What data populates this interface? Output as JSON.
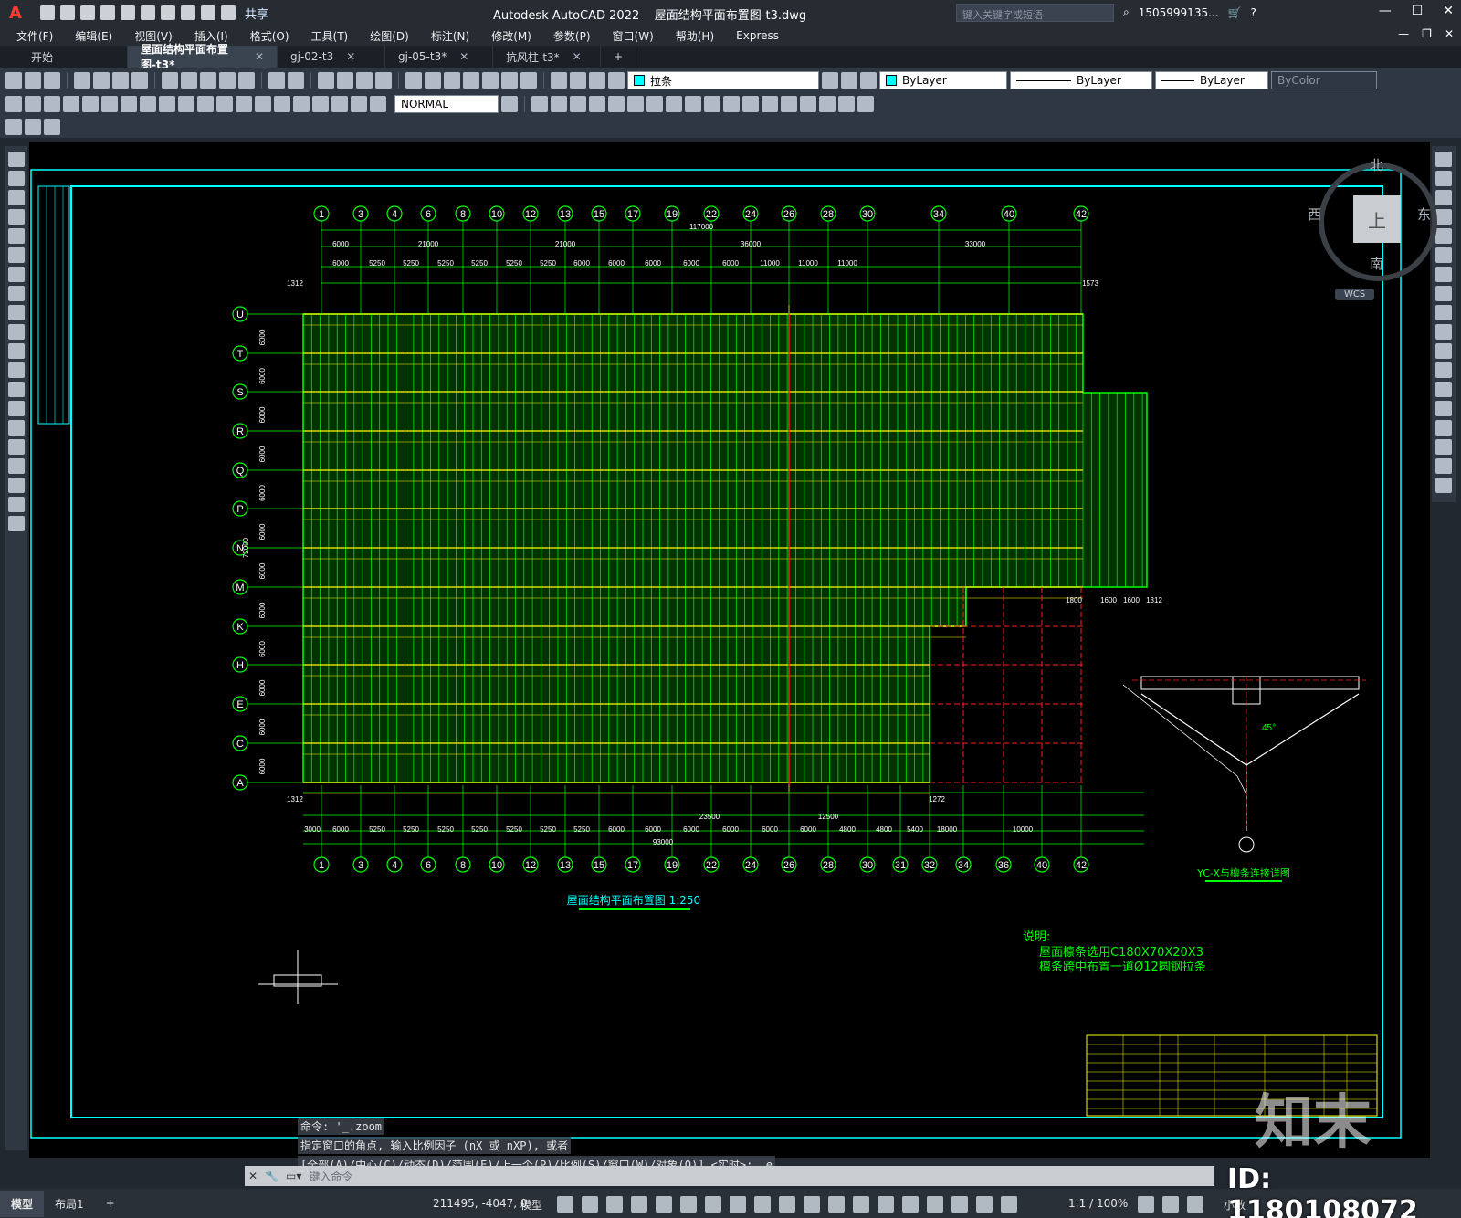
{
  "app": {
    "title": "Autodesk AutoCAD 2022",
    "file": "屋面结构平面布置图-t3.dwg",
    "share_label": "共享",
    "search_placeholder": "键入关键字或短语",
    "user": "1505999135...",
    "logo": "A"
  },
  "menu": [
    "文件(F)",
    "编辑(E)",
    "视图(V)",
    "插入(I)",
    "格式(O)",
    "工具(T)",
    "绘图(D)",
    "标注(N)",
    "修改(M)",
    "参数(P)",
    "窗口(W)",
    "帮助(H)",
    "Express"
  ],
  "tabs": [
    {
      "label": "开始",
      "active": false
    },
    {
      "label": "屋面结构平面布置图-t3*",
      "active": true
    },
    {
      "label": "gj-02-t3",
      "active": false
    },
    {
      "label": "gj-05-t3*",
      "active": false
    },
    {
      "label": "抗风柱-t3*",
      "active": false
    }
  ],
  "toolbar": {
    "layer": "拉条",
    "color": "ByLayer",
    "linetype": "ByLayer",
    "lineweight": "ByLayer",
    "plotstyle": "ByColor",
    "textstyle": "NORMAL"
  },
  "viewcube": {
    "n": "北",
    "s": "南",
    "e": "东",
    "w": "西",
    "top": "上",
    "wcs": "WCS"
  },
  "drawing": {
    "axes_top": [
      "1",
      "3",
      "4",
      "6",
      "8",
      "10",
      "12",
      "13",
      "15",
      "17",
      "19",
      "22",
      "24",
      "26",
      "28",
      "30",
      "34",
      "40",
      "42"
    ],
    "axes_bottom": [
      "1",
      "3",
      "4",
      "6",
      "8",
      "10",
      "12",
      "13",
      "15",
      "17",
      "19",
      "22",
      "24",
      "26",
      "28",
      "30",
      "31",
      "32",
      "34",
      "36",
      "40",
      "42"
    ],
    "axes_left": [
      "U",
      "T",
      "S",
      "R",
      "Q",
      "P",
      "N",
      "M",
      "K",
      "H",
      "E",
      "C",
      "A"
    ],
    "total_top": "117000",
    "dims_top_row1": [
      "6000",
      "21000",
      "21000",
      "36000",
      "33000"
    ],
    "dims_top_row2": [
      "6000",
      "5250",
      "5250",
      "5250",
      "5250",
      "5250",
      "5250",
      "6000",
      "6000",
      "6000",
      "6000",
      "6000",
      "11000",
      "11000",
      "11000"
    ],
    "dims_bottom_row1": [
      "3000",
      "6000",
      "5250",
      "5250",
      "5250",
      "5250",
      "5250",
      "5250",
      "5250",
      "6000",
      "6000",
      "6000",
      "6000",
      "6000",
      "6000",
      "4800",
      "4800",
      "5400",
      "18000",
      "10000"
    ],
    "dim_bottom_total": "93000",
    "dim_bottom_23500": "23500",
    "dim_bottom_12500": "12500",
    "left_dims": [
      "6000",
      "6000",
      "6000",
      "6000",
      "6000",
      "6000",
      "6000",
      "6000",
      "6000",
      "6000",
      "6000",
      "6000"
    ],
    "left_total": "72000",
    "plan_title": "屋面结构平面布置图 1:250",
    "detail_title": "YC-X与檩条连接详图",
    "detail_45": "45°",
    "note_title": "说明:",
    "note_line1": "屋面檩条选用C180X70X20X3",
    "note_line2": "檩条跨中布置一道Ø12圆钢拉条",
    "edge_1312": "1312",
    "edge_1573": "1573",
    "edge_1272": "1272",
    "right_dims": [
      "1800",
      "1600",
      "1600",
      "1312"
    ]
  },
  "command": {
    "history": [
      "命令: '_.zoom",
      "指定窗口的角点, 输入比例因子 (nX 或 nXP), 或者",
      "[全部(A)/中心(C)/动态(D)/范围(E)/上一个(P)/比例(S)/窗口(W)/对象(O)] <实时>: _e"
    ],
    "placeholder": "键入命令"
  },
  "status": {
    "tabs": [
      "模型",
      "布局1"
    ],
    "coords": "211495, -4047, 0",
    "model": "模型",
    "scale": "1:1 / 100%",
    "units": "小数"
  },
  "watermark": {
    "logo": "知末",
    "id": "ID: 1180108072"
  },
  "colors": {
    "grid_green": "#00ff00",
    "grid_yellow": "#ffff00",
    "grid_red": "#ff2020",
    "cyan": "#00ffff",
    "bg": "#000000"
  }
}
